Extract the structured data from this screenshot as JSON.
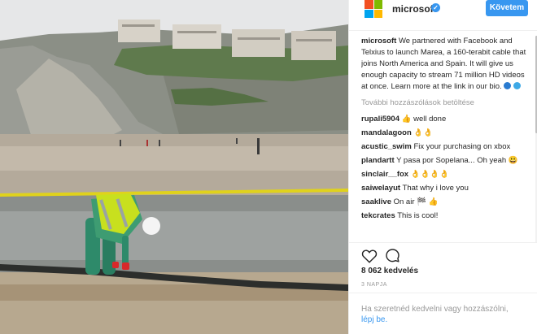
{
  "post": {
    "photo_alt": "",
    "header": {
      "username": "microsoft",
      "follow_label": "Követem",
      "verified_mark": "✓"
    },
    "caption": {
      "username": "microsoft",
      "text": "We partnered with Facebook and Telxius to launch Marea, a 160-terabit cable that joins North America and Spain. It will give us enough capacity to stream 71 million HD videos at once. Learn more at the link in our bio."
    },
    "load_more_label": "További hozzászólások betöltése",
    "comments": [
      {
        "user": "rupali5904",
        "text": "👍 well done"
      },
      {
        "user": "mandalagoon",
        "text": "👌👌"
      },
      {
        "user": "acustic_swim",
        "text": "Fix your purchasing on xbox"
      },
      {
        "user": "plandartt",
        "text": "Y pasa por Sopelana... Oh yeah 😃"
      },
      {
        "user": "sinclair__fox",
        "text": "👌👌👌👌"
      },
      {
        "user": "saiwelayut",
        "text": "That why i love you"
      },
      {
        "user": "saaklive",
        "text": "On air 🏁 👍"
      },
      {
        "user": "tekcrates",
        "text": "This is cool!"
      }
    ],
    "likes": "8 062 kedvelés",
    "time_ago": "3 NAPJA",
    "login_prompt": "Ha szeretnéd kedvelni vagy hozzászólni,",
    "login_link": "lépj be."
  },
  "colors": {
    "accent": "#3897f0",
    "ms_red": "#f25022",
    "ms_green": "#7fba00",
    "ms_blue": "#00a4ef",
    "ms_yellow": "#ffb900"
  },
  "icons": [
    "microsoft-logo-icon",
    "verified-icon",
    "heart-icon",
    "comment-icon",
    "globe-emoji-icon",
    "pacman-emoji-icon"
  ]
}
